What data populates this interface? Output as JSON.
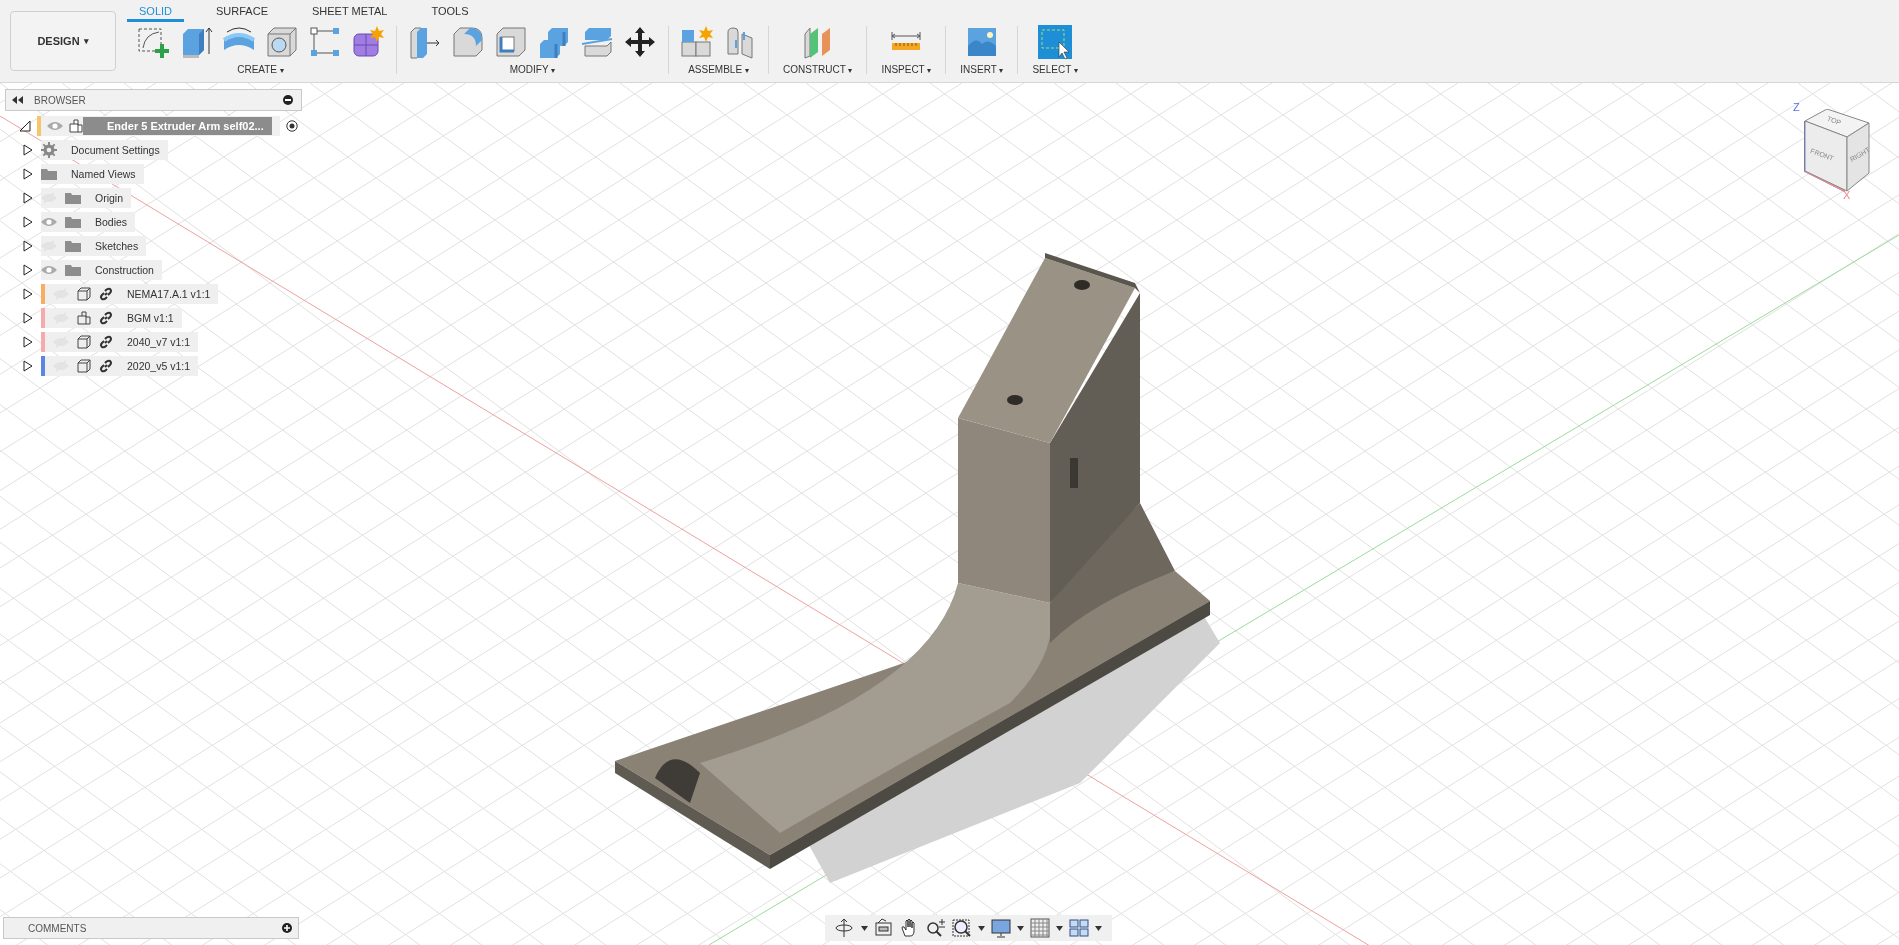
{
  "workspace": {
    "label": "DESIGN",
    "caret": "▾"
  },
  "tabs": [
    {
      "label": "SOLID",
      "selected": true
    },
    {
      "label": "SURFACE",
      "selected": false
    },
    {
      "label": "SHEET METAL",
      "selected": false
    },
    {
      "label": "TOOLS",
      "selected": false
    }
  ],
  "groups": [
    {
      "label": "CREATE",
      "caret": "▾"
    },
    {
      "label": "MODIFY",
      "caret": "▾"
    },
    {
      "label": "ASSEMBLE",
      "caret": "▾"
    },
    {
      "label": "CONSTRUCT",
      "caret": "▾"
    },
    {
      "label": "INSPECT",
      "caret": "▾"
    },
    {
      "label": "INSERT",
      "caret": "▾"
    },
    {
      "label": "SELECT",
      "caret": "▾"
    }
  ],
  "browser": {
    "title": "BROWSER",
    "tree": [
      {
        "label": "Ender 5 Extruder Arm self02...",
        "kind": "document",
        "expanded": true,
        "visible": true,
        "color": "#f7c46c",
        "children": [
          {
            "label": "Document Settings",
            "kind": "settings",
            "expanded": false
          },
          {
            "label": "Named Views",
            "kind": "folder",
            "expanded": false
          },
          {
            "label": "Origin",
            "kind": "folder",
            "expanded": false,
            "visible": false
          },
          {
            "label": "Bodies",
            "kind": "folder",
            "expanded": false,
            "visible": true
          },
          {
            "label": "Sketches",
            "kind": "folder",
            "expanded": false,
            "visible": false
          },
          {
            "label": "Construction",
            "kind": "folder",
            "expanded": false,
            "visible": true
          },
          {
            "label": "NEMA17.A.1 v1:1",
            "kind": "component",
            "expanded": false,
            "visible": false,
            "color": "#f9ad5e"
          },
          {
            "label": "BGM v1:1",
            "kind": "assembly",
            "expanded": false,
            "visible": false,
            "color": "#f7a9ad"
          },
          {
            "label": "2040_v7 v1:1",
            "kind": "component",
            "expanded": false,
            "visible": false,
            "color": "#f7a9ad"
          },
          {
            "label": "2020_v5 v1:1",
            "kind": "component",
            "expanded": false,
            "visible": false,
            "color": "#5b86e5"
          }
        ]
      }
    ]
  },
  "view_cube": {
    "faces": [
      "TOP",
      "FRONT",
      "RIGHT"
    ],
    "axes": [
      "Z",
      "X"
    ]
  },
  "comments": {
    "title": "COMMENTS"
  }
}
